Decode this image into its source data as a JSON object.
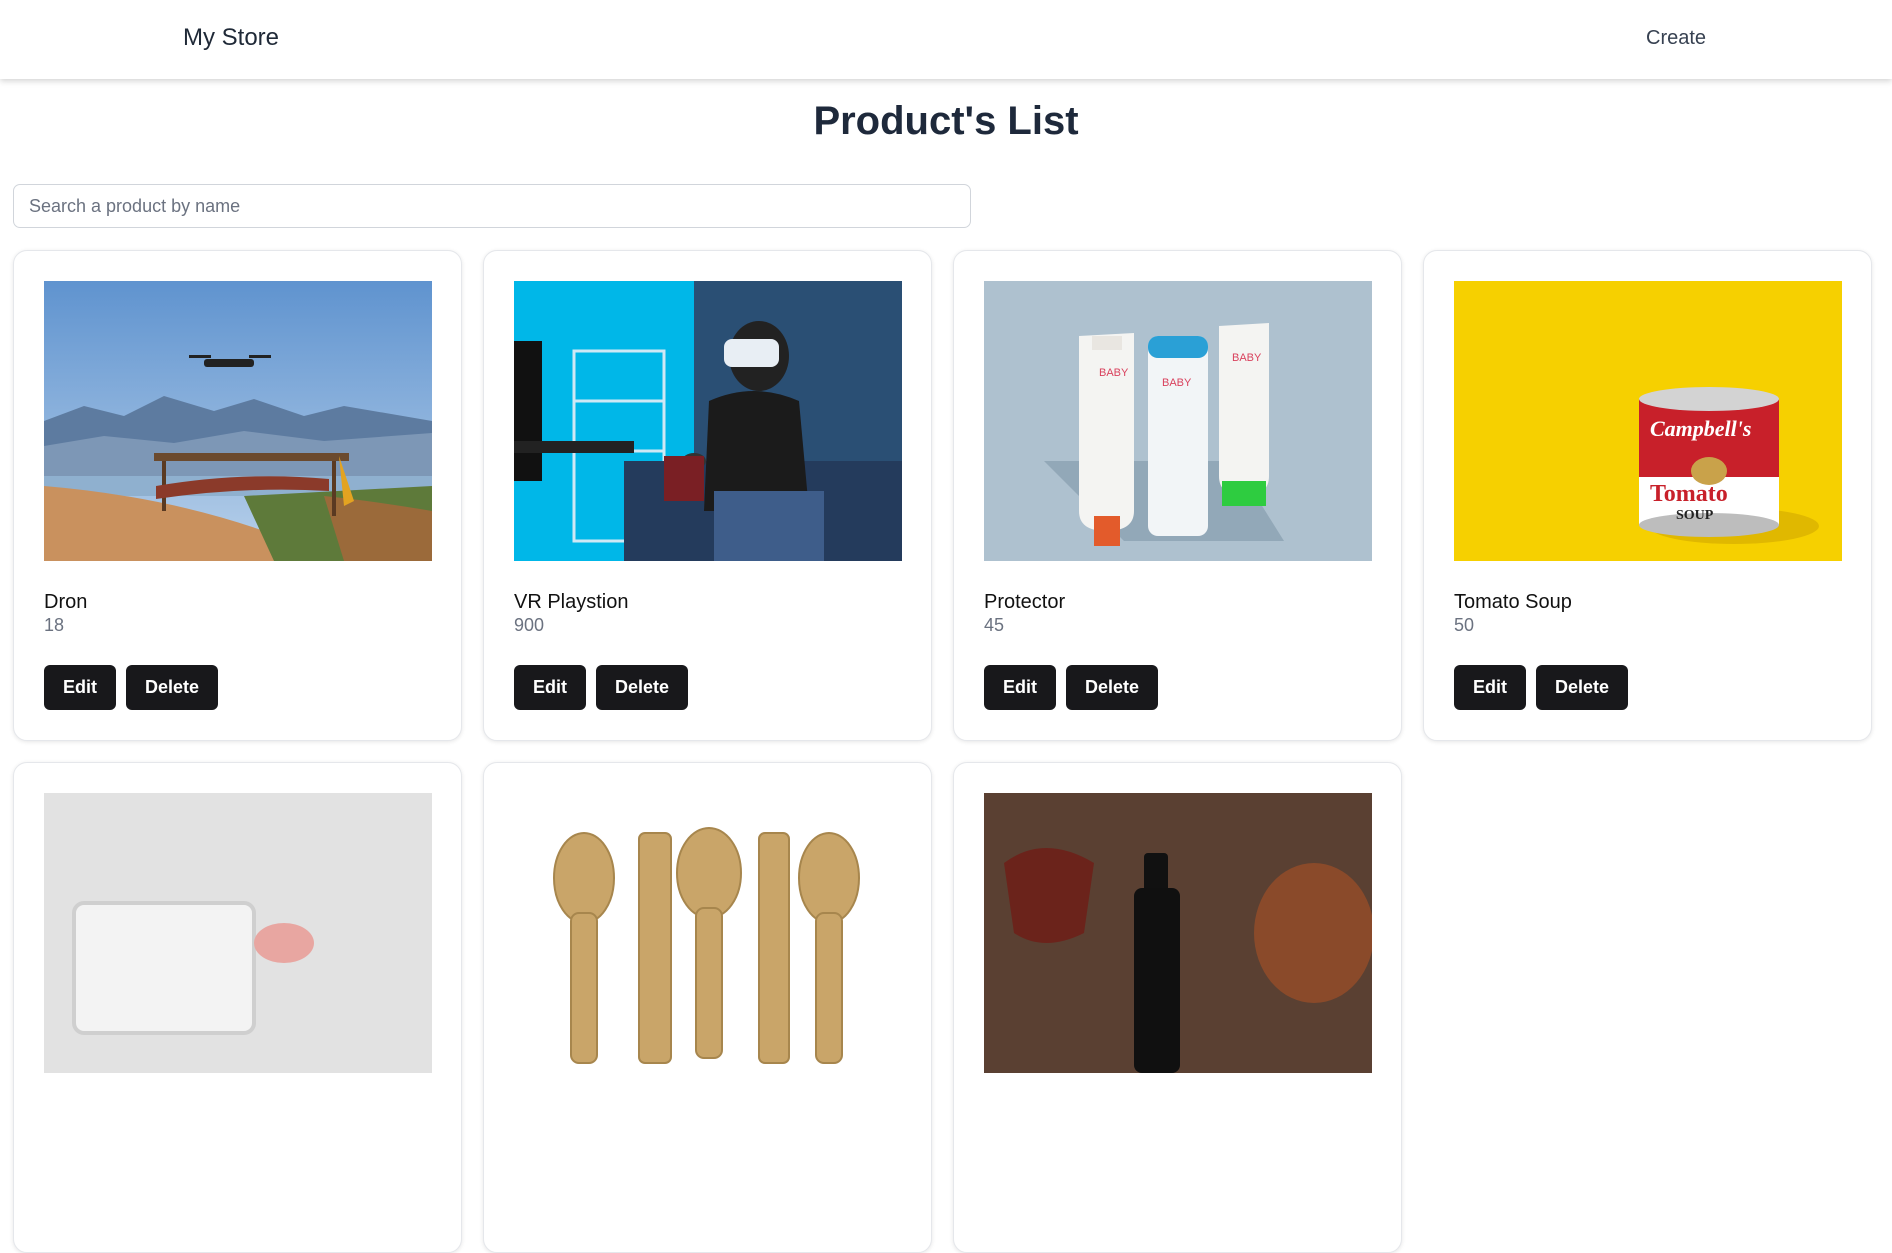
{
  "navbar": {
    "brand": "My Store",
    "create_label": "Create"
  },
  "page": {
    "title": "Product's List"
  },
  "search": {
    "placeholder": "Search a product by name",
    "value": ""
  },
  "buttons": {
    "edit_label": "Edit",
    "delete_label": "Delete"
  },
  "products": [
    {
      "name": "Dron",
      "price": "18",
      "image": "drone-over-mountains-photo"
    },
    {
      "name": "VR Playstion",
      "price": "900",
      "image": "person-with-vr-headset-photo"
    },
    {
      "name": "Protector",
      "price": "45",
      "image": "baby-spa-products-photo"
    },
    {
      "name": "Tomato Soup",
      "price": "50",
      "image": "tomato-soup-can-photo"
    },
    {
      "name": "",
      "price": "",
      "image": "white-tray-photo"
    },
    {
      "name": "",
      "price": "",
      "image": "wooden-spoons-photo"
    },
    {
      "name": "",
      "price": "",
      "image": "glass-and-dropper-bottle-photo"
    }
  ]
}
